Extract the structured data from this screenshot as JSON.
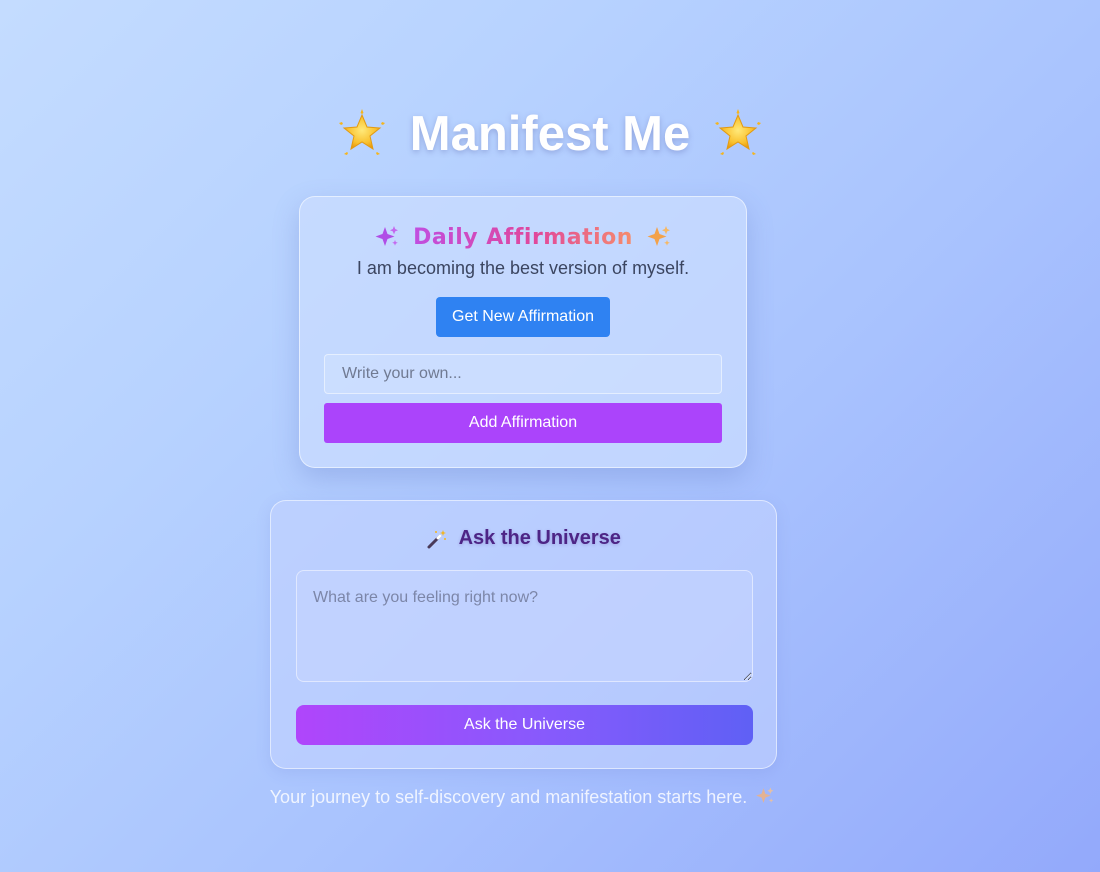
{
  "app": {
    "title": "Manifest Me",
    "title_icon": "glowing-star-icon"
  },
  "affirmation": {
    "heading": "Daily Affirmation",
    "heading_icon": "sparkles-icon",
    "current": "I am becoming the best version of myself.",
    "new_button_label": "Get New Affirmation",
    "input_placeholder": "Write your own...",
    "input_value": "",
    "add_button_label": "Add Affirmation"
  },
  "universe": {
    "heading": "Ask the Universe",
    "heading_icon": "magic-wand-icon",
    "textarea_placeholder": "What are you feeling right now?",
    "textarea_value": "",
    "ask_button_label": "Ask the Universe"
  },
  "footer": {
    "text": "Your journey to self-discovery and manifestation starts here.",
    "icon": "sparkles-icon"
  },
  "colors": {
    "primary_button": "#2f82f2",
    "add_button": "#ab44fb",
    "ask_gradient_start": "#b045fb",
    "ask_gradient_end": "#5f60f5",
    "heading_purple": "#4d2586"
  }
}
